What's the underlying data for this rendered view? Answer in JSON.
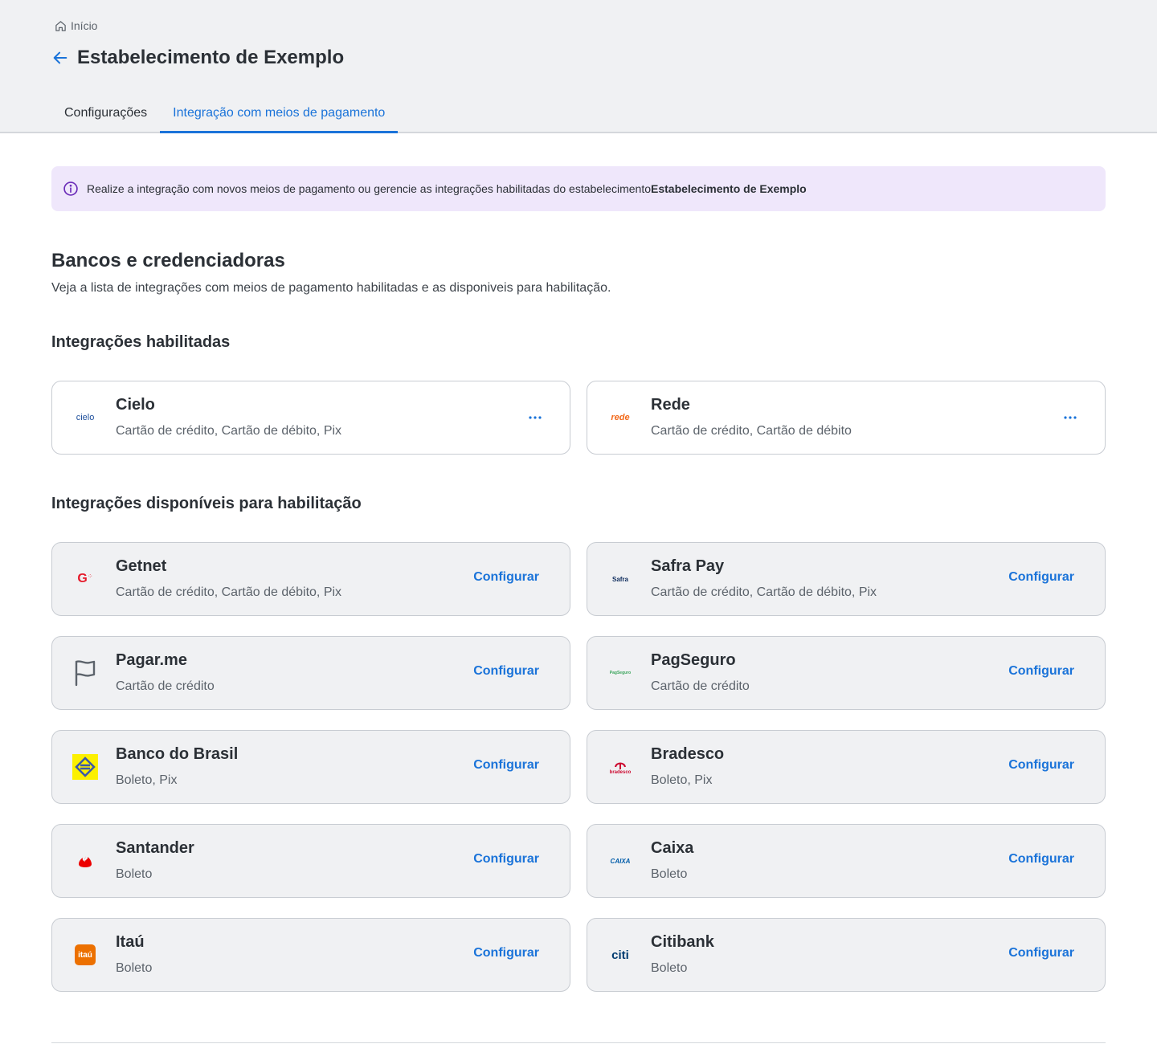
{
  "breadcrumb": {
    "home_label": "Início"
  },
  "header": {
    "title": "Estabelecimento de Exemplo"
  },
  "tabs": [
    {
      "label": "Configurações",
      "active": false
    },
    {
      "label": "Integração com meios de pagamento",
      "active": true
    }
  ],
  "info": {
    "text": "Realize a integração com novos meios de pagamento ou gerencie as integrações habilitadas do estabelecimento ",
    "establishment": "Estabelecimento de Exemplo"
  },
  "section": {
    "title": "Bancos e credenciadoras",
    "description": "Veja a lista de integrações com meios de pagamento habilitadas e as disponiveis para habilitação."
  },
  "enabled": {
    "title": "Integrações habilitadas",
    "items": [
      {
        "name": "Cielo",
        "methods": "Cartão de crédito, Cartão de débito, Pix",
        "logo_text": "cielo",
        "logo_color": "#1e4f9c"
      },
      {
        "name": "Rede",
        "methods": "Cartão de crédito, Cartão de débito",
        "logo_text": "rede",
        "logo_color": "#f26a1b"
      }
    ]
  },
  "available": {
    "title": "Integrações disponíveis para habilitação",
    "action_label": "Configurar",
    "items": [
      {
        "name": "Getnet",
        "methods": "Cartão de crédito, Cartão de débito, Pix",
        "logo_text": "G",
        "logo_color": "#e5192a"
      },
      {
        "name": "Safra Pay",
        "methods": "Cartão de crédito, Cartão de débito, Pix",
        "logo_text": "Safra",
        "logo_color": "#0d2b5c"
      },
      {
        "name": "Pagar.me",
        "methods": "Cartão de crédito",
        "logo_text": "",
        "logo_color": "#5c636b"
      },
      {
        "name": "PagSeguro",
        "methods": "Cartão de crédito",
        "logo_text": "PagSeguro",
        "logo_color": "#3ba55c"
      },
      {
        "name": "Banco do Brasil",
        "methods": "Boleto, Pix",
        "logo_text": "",
        "logo_color": "#fcf000"
      },
      {
        "name": "Bradesco",
        "methods": "Boleto, Pix",
        "logo_text": "bradesco",
        "logo_color": "#cc092f"
      },
      {
        "name": "Santander",
        "methods": "Boleto",
        "logo_text": "",
        "logo_color": "#ec0000"
      },
      {
        "name": "Caixa",
        "methods": "Boleto",
        "logo_text": "CAIXA",
        "logo_color": "#005ca9"
      },
      {
        "name": "Itaú",
        "methods": "Boleto",
        "logo_text": "itaú",
        "logo_color": "#ec7000"
      },
      {
        "name": "Citibank",
        "methods": "Boleto",
        "logo_text": "citi",
        "logo_color": "#003b70"
      }
    ]
  },
  "colors": {
    "accent": "#1a73d9",
    "info_bg": "#efe7fb",
    "info_icon": "#6a2bb8",
    "card_bg": "#f0f1f3"
  }
}
